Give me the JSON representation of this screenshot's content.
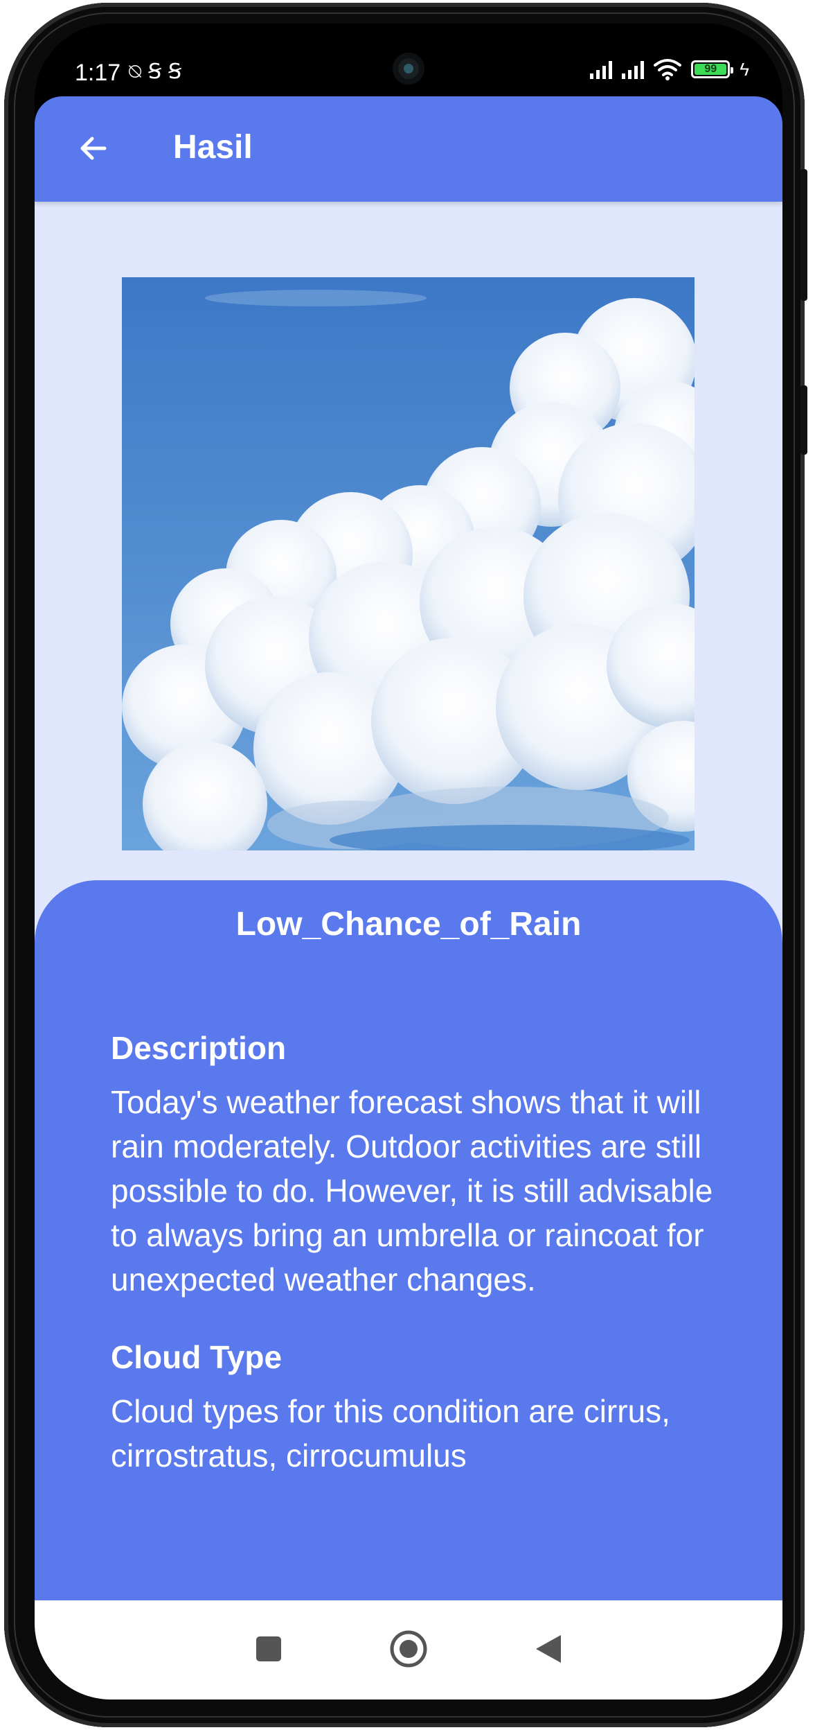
{
  "status_bar": {
    "time": "1:17",
    "left_icons": [
      "muted-alarm-icon",
      "s-icon",
      "s-icon"
    ],
    "right_icons": [
      "signal-icon",
      "signal-icon",
      "wifi-icon",
      "battery-icon",
      "charging-icon"
    ],
    "battery_level": "99"
  },
  "appbar": {
    "title": "Hasil",
    "back_icon": "arrow-left-icon"
  },
  "result": {
    "image_alt": "cumulus clouds in blue sky",
    "label": "Low_Chance_of_Rain",
    "sections": [
      {
        "heading": "Description",
        "text": "Today's weather forecast shows that it will rain moderately. Outdoor activities are still possible to do. However, it is still advisable to always bring an umbrella or raincoat for unexpected weather changes."
      },
      {
        "heading": "Cloud Type",
        "text": "Cloud types for this condition are cirrus, cirrostratus, cirrocumulus"
      }
    ]
  },
  "nav_bar": {
    "buttons": [
      "recents-square-icon",
      "home-circle-icon",
      "back-triangle-icon"
    ]
  },
  "colors": {
    "primary": "#5a79ec",
    "background": "#e0e6fc",
    "text_on_primary": "#ffffff"
  }
}
